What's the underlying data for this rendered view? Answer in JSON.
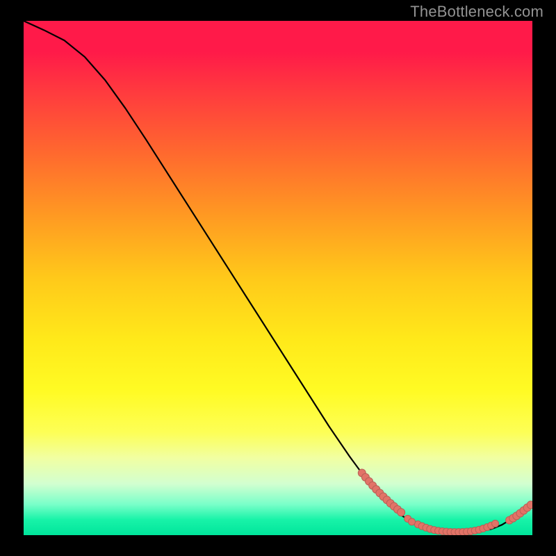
{
  "watermark": "TheBottleneck.com",
  "chart_data": {
    "type": "line",
    "title": "",
    "xlabel": "",
    "ylabel": "",
    "xlim": [
      0,
      100
    ],
    "ylim": [
      0,
      100
    ],
    "series": [
      {
        "name": "curve",
        "x": [
          0,
          4,
          8,
          12,
          16,
          20,
          24,
          28,
          32,
          36,
          40,
          44,
          48,
          52,
          56,
          60,
          64,
          68,
          70,
          72,
          74,
          76,
          78,
          80,
          82,
          84,
          86,
          88,
          90,
          92,
          94,
          96,
          98,
          100
        ],
        "y": [
          100,
          98.2,
          96.2,
          93.0,
          88.5,
          83.0,
          77.0,
          70.8,
          64.6,
          58.4,
          52.2,
          46.0,
          39.8,
          33.6,
          27.4,
          21.2,
          15.4,
          10.0,
          7.6,
          5.6,
          4.0,
          2.8,
          1.9,
          1.3,
          0.9,
          0.7,
          0.6,
          0.6,
          0.8,
          1.2,
          2.0,
          3.2,
          4.6,
          6.0
        ]
      }
    ],
    "scatter": [
      {
        "name": "dots-slope",
        "x": [
          66.5,
          67.2,
          67.9,
          68.6,
          69.3,
          70.0,
          70.7,
          71.4,
          72.1,
          72.8,
          73.5,
          74.2
        ],
        "y": [
          12.1,
          11.25,
          10.45,
          9.65,
          8.9,
          8.2,
          7.5,
          6.85,
          6.2,
          5.6,
          5.0,
          4.45
        ],
        "r": 5.5
      },
      {
        "name": "dots-valley",
        "x": [
          77.5,
          78.3,
          79.1,
          79.9,
          80.7,
          81.5,
          82.3,
          83.1,
          83.9,
          84.7,
          85.5,
          86.3,
          87.1,
          87.9,
          88.7,
          89.5,
          90.3,
          91.1,
          91.9,
          92.7
        ],
        "y": [
          2.1,
          1.75,
          1.45,
          1.2,
          1.0,
          0.85,
          0.75,
          0.68,
          0.63,
          0.6,
          0.6,
          0.62,
          0.67,
          0.75,
          0.88,
          1.05,
          1.28,
          1.55,
          1.88,
          2.25
        ],
        "r": 5.0
      },
      {
        "name": "dots-mid-gap",
        "x": [
          75.5,
          76.3
        ],
        "y": [
          3.2,
          2.6
        ],
        "r": 5.0
      },
      {
        "name": "dots-tail",
        "x": [
          95.5,
          96.2,
          96.9,
          97.6,
          98.3,
          99.0,
          99.7
        ],
        "y": [
          2.9,
          3.3,
          3.75,
          4.25,
          4.8,
          5.35,
          5.9
        ],
        "r": 5.5
      }
    ],
    "gradient_stops": [
      {
        "pos": 0,
        "color": "#ff1a49"
      },
      {
        "pos": 50,
        "color": "#ffc91a"
      },
      {
        "pos": 80,
        "color": "#fdff56"
      },
      {
        "pos": 100,
        "color": "#00e59b"
      }
    ],
    "dot_fill": "#e27367",
    "dot_stroke": "#b86056"
  }
}
